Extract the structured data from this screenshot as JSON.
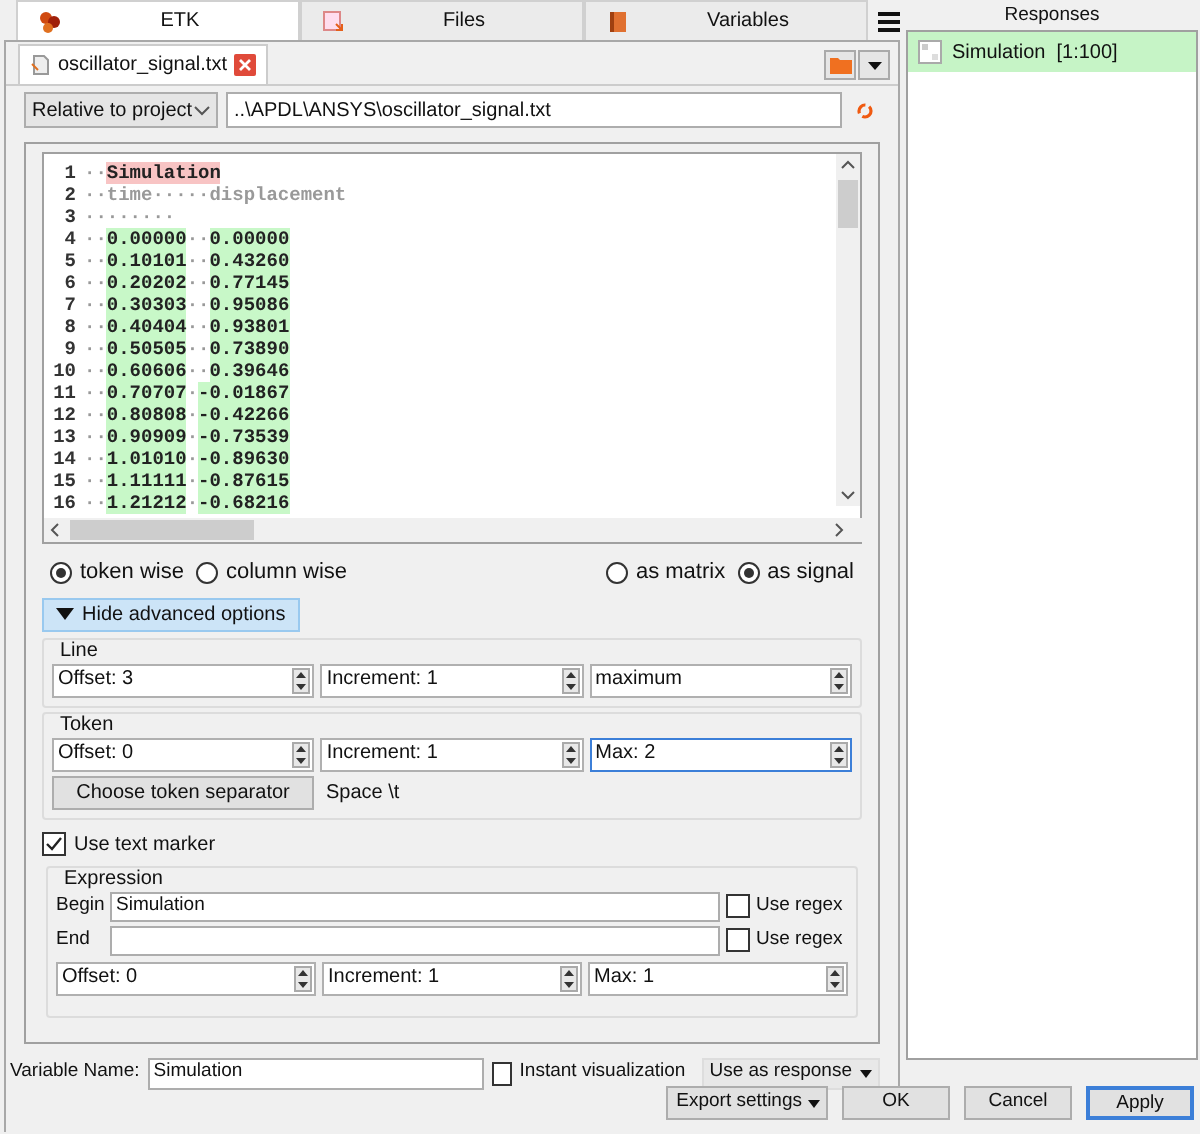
{
  "tabs": [
    {
      "label": "ETK",
      "selected": true
    },
    {
      "label": "Files",
      "selected": false
    },
    {
      "label": "Variables",
      "selected": false
    }
  ],
  "file_tab": {
    "label": "oscillator_signal.txt"
  },
  "path": {
    "mode": "Relative to project",
    "value": "..\\APDL\\ANSYS\\oscillator_signal.txt"
  },
  "editor": {
    "lines": [
      {
        "number": "1",
        "tokens": [
          {
            "text": "··",
            "kind": "plain"
          },
          {
            "text": "Simulation",
            "kind": "marker"
          }
        ]
      },
      {
        "number": "2",
        "tokens": [
          {
            "text": "··time·····displacement",
            "kind": "plain"
          }
        ]
      },
      {
        "number": "3",
        "tokens": [
          {
            "text": "········",
            "kind": "plain"
          }
        ]
      },
      {
        "number": "4",
        "tokens": [
          {
            "text": "··",
            "kind": "plain"
          },
          {
            "text": "0.00000",
            "kind": "value"
          },
          {
            "text": "··",
            "kind": "plain"
          },
          {
            "text": "0.00000",
            "kind": "value"
          }
        ]
      },
      {
        "number": "5",
        "tokens": [
          {
            "text": "··",
            "kind": "plain"
          },
          {
            "text": "0.10101",
            "kind": "value"
          },
          {
            "text": "··",
            "kind": "plain"
          },
          {
            "text": "0.43260",
            "kind": "value"
          }
        ]
      },
      {
        "number": "6",
        "tokens": [
          {
            "text": "··",
            "kind": "plain"
          },
          {
            "text": "0.20202",
            "kind": "value"
          },
          {
            "text": "··",
            "kind": "plain"
          },
          {
            "text": "0.77145",
            "kind": "value"
          }
        ]
      },
      {
        "number": "7",
        "tokens": [
          {
            "text": "··",
            "kind": "plain"
          },
          {
            "text": "0.30303",
            "kind": "value"
          },
          {
            "text": "··",
            "kind": "plain"
          },
          {
            "text": "0.95086",
            "kind": "value"
          }
        ]
      },
      {
        "number": "8",
        "tokens": [
          {
            "text": "··",
            "kind": "plain"
          },
          {
            "text": "0.40404",
            "kind": "value"
          },
          {
            "text": "··",
            "kind": "plain"
          },
          {
            "text": "0.93801",
            "kind": "value"
          }
        ]
      },
      {
        "number": "9",
        "tokens": [
          {
            "text": "··",
            "kind": "plain"
          },
          {
            "text": "0.50505",
            "kind": "value"
          },
          {
            "text": "··",
            "kind": "plain"
          },
          {
            "text": "0.73890",
            "kind": "value"
          }
        ]
      },
      {
        "number": "10",
        "tokens": [
          {
            "text": "··",
            "kind": "plain"
          },
          {
            "text": "0.60606",
            "kind": "value"
          },
          {
            "text": "··",
            "kind": "plain"
          },
          {
            "text": "0.39646",
            "kind": "value"
          }
        ]
      },
      {
        "number": "11",
        "tokens": [
          {
            "text": "··",
            "kind": "plain"
          },
          {
            "text": "0.70707",
            "kind": "value"
          },
          {
            "text": "·",
            "kind": "plain"
          },
          {
            "text": "-0.01867",
            "kind": "value"
          }
        ]
      },
      {
        "number": "12",
        "tokens": [
          {
            "text": "··",
            "kind": "plain"
          },
          {
            "text": "0.80808",
            "kind": "value"
          },
          {
            "text": "·",
            "kind": "plain"
          },
          {
            "text": "-0.42266",
            "kind": "value"
          }
        ]
      },
      {
        "number": "13",
        "tokens": [
          {
            "text": "··",
            "kind": "plain"
          },
          {
            "text": "0.90909",
            "kind": "value"
          },
          {
            "text": "·",
            "kind": "plain"
          },
          {
            "text": "-0.73539",
            "kind": "value"
          }
        ]
      },
      {
        "number": "14",
        "tokens": [
          {
            "text": "··",
            "kind": "plain"
          },
          {
            "text": "1.01010",
            "kind": "value"
          },
          {
            "text": "·",
            "kind": "plain"
          },
          {
            "text": "-0.89630",
            "kind": "value"
          }
        ]
      },
      {
        "number": "15",
        "tokens": [
          {
            "text": "··",
            "kind": "plain"
          },
          {
            "text": "1.11111",
            "kind": "value"
          },
          {
            "text": "·",
            "kind": "plain"
          },
          {
            "text": "-0.87615",
            "kind": "value"
          }
        ]
      },
      {
        "number": "16",
        "tokens": [
          {
            "text": "··",
            "kind": "plain"
          },
          {
            "text": "1.21212",
            "kind": "value"
          },
          {
            "text": "·",
            "kind": "plain"
          },
          {
            "text": "-0.68216",
            "kind": "value"
          }
        ]
      }
    ]
  },
  "read_mode": [
    {
      "label": "token wise",
      "selected": true
    },
    {
      "label": "column wise",
      "selected": false
    }
  ],
  "output_mode": [
    {
      "label": "as matrix",
      "selected": false
    },
    {
      "label": "as signal",
      "selected": true
    }
  ],
  "advanced_toggle": {
    "label": "Hide advanced options",
    "expanded": true
  },
  "line_group": {
    "title": "Line",
    "fields": [
      {
        "text": "Offset: 3",
        "focused": false
      },
      {
        "text": "Increment: 1",
        "focused": false
      },
      {
        "text": "maximum",
        "focused": false
      }
    ]
  },
  "token_group": {
    "title": "Token",
    "fields": [
      {
        "text": "Offset: 0",
        "focused": false
      },
      {
        "text": "Increment: 1",
        "focused": false
      },
      {
        "text": "Max: 2",
        "focused": true
      }
    ],
    "separator_button": "Choose token separator",
    "separator": "Space \\t"
  },
  "text_marker": {
    "label": "Use text marker",
    "checked": true
  },
  "expression": {
    "title": "Expression",
    "rows": [
      {
        "label": "Begin",
        "value": "Simulation",
        "regex_label": "Use regex",
        "regex": false
      },
      {
        "label": "End",
        "regex_label": "Use regex",
        "regex": false
      }
    ],
    "fields": [
      {
        "text": "Offset: 0",
        "focused": false
      },
      {
        "text": "Increment: 1",
        "focused": false
      },
      {
        "text": "Max: 1",
        "focused": false
      }
    ]
  },
  "variable": {
    "label": "Variable Name:",
    "value": "Simulation",
    "instant_label": "Instant visualization",
    "instant": false,
    "use_as": "Use as response"
  },
  "buttons": [
    {
      "label": "Export settings",
      "kind": "split",
      "default": false
    },
    {
      "label": "OK",
      "kind": "plain",
      "default": false
    },
    {
      "label": "Cancel",
      "kind": "plain",
      "default": false
    },
    {
      "label": "Apply",
      "kind": "plain",
      "default": true
    }
  ],
  "responses": {
    "title": "Responses",
    "items": [
      {
        "label": "Simulation  [1:100]",
        "selected": true
      }
    ]
  }
}
